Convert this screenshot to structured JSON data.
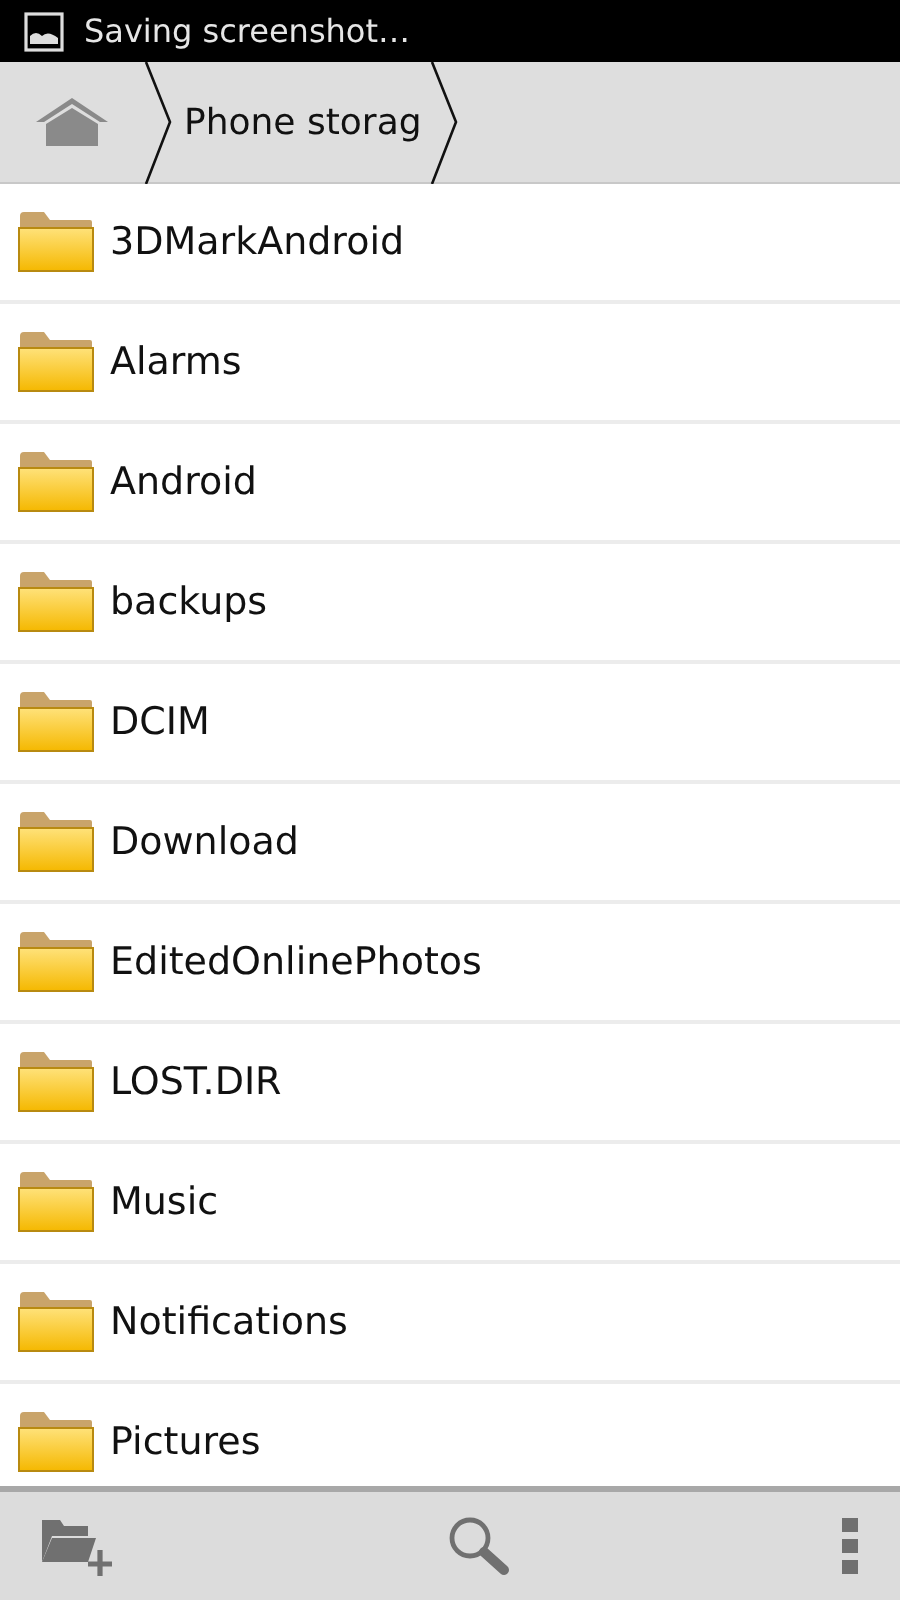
{
  "status_bar": {
    "notification": "Saving screenshot…"
  },
  "breadcrumb": {
    "items": [
      "Phone storag"
    ]
  },
  "folders": [
    {
      "name": "3DMarkAndroid"
    },
    {
      "name": "Alarms"
    },
    {
      "name": "Android"
    },
    {
      "name": "backups"
    },
    {
      "name": "DCIM"
    },
    {
      "name": "Download"
    },
    {
      "name": "EditedOnlinePhotos"
    },
    {
      "name": "LOST.DIR"
    },
    {
      "name": "Music"
    },
    {
      "name": "Notifications"
    },
    {
      "name": "Pictures"
    }
  ]
}
